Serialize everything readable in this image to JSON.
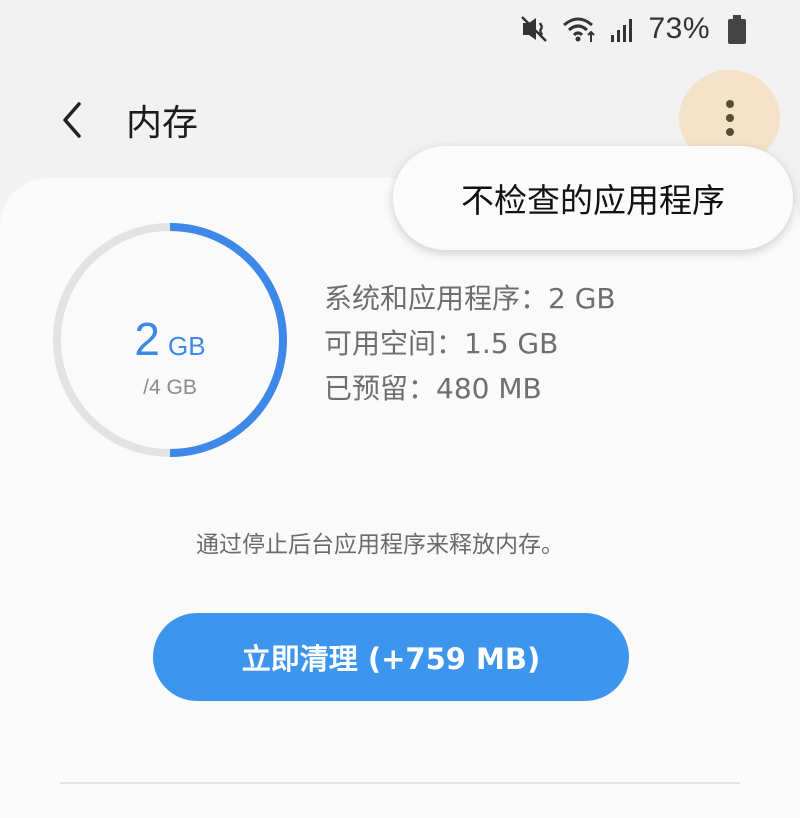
{
  "status_bar": {
    "battery_percent": "73%",
    "icons": [
      "mute-vibrate-icon",
      "wifi-icon",
      "signal-icon",
      "battery-icon"
    ]
  },
  "app_bar": {
    "title": "内存",
    "back_icon": "chevron-left-icon",
    "more_icon": "more-vertical-icon"
  },
  "popup_menu": {
    "items": [
      "不检查的应用程序"
    ]
  },
  "memory": {
    "used_value": "2",
    "used_unit": "GB",
    "total": "/4 GB",
    "used_fraction": 0.5,
    "accent_color": "#3d88e8",
    "track_color": "#e3e3e3",
    "stats": [
      "系统和应用程序：2 GB",
      "可用空间：1.5 GB",
      "已预留：480 MB"
    ]
  },
  "hint": "通过停止后台应用程序来释放内存。",
  "clean_button": {
    "label": "立即清理 (+759 MB)",
    "color": "#3e95ee"
  }
}
